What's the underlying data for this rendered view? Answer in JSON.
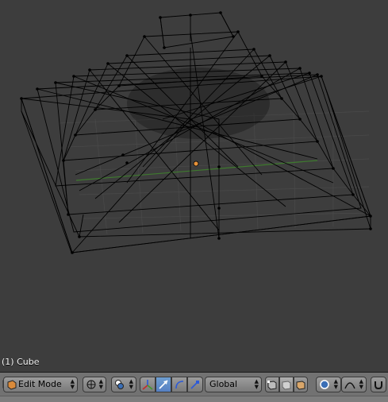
{
  "viewport": {
    "object_label": "(1) Cube"
  },
  "header": {
    "editor_type_icon": "3d-view-icon",
    "mode_select": {
      "value": "Edit Mode",
      "icon": "edit-mode-icon"
    },
    "pivot_icon": "pivot-point-icon",
    "shading_icon": "viewport-shading-icon",
    "manipulator_icons": [
      "manipulator-toggle-icon",
      "translate-icon",
      "rotate-icon",
      "scale-icon"
    ],
    "orientation_select": {
      "value": "Global"
    },
    "select_mode_icons": [
      "vertex-select-icon",
      "edge-select-icon",
      "face-select-icon"
    ],
    "proportional_icon": "proportional-edit-icon",
    "falloff_icon": "falloff-curve-icon",
    "snap_icon": "snap-icon"
  },
  "colors": {
    "wire": "#000000",
    "grid_x_axis": "#3e7a2e",
    "origin": "#e6923a",
    "viewport_bg": "#3d3d3d",
    "header_bg": "#727272",
    "active_button": "#5680c2"
  }
}
